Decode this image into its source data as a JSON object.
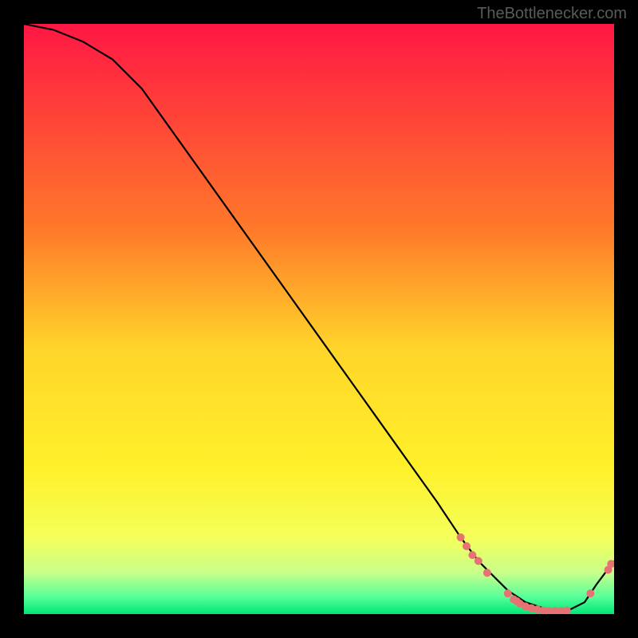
{
  "watermark": "TheBottlenecker.com",
  "chart_data": {
    "type": "line",
    "title": "",
    "xlabel": "",
    "ylabel": "",
    "xlim": [
      0,
      100
    ],
    "ylim": [
      0,
      100
    ],
    "background_gradient": {
      "stops": [
        {
          "offset": 0,
          "color": "#ff1744"
        },
        {
          "offset": 35,
          "color": "#ff7a2a"
        },
        {
          "offset": 55,
          "color": "#ffd52a"
        },
        {
          "offset": 75,
          "color": "#fff02a"
        },
        {
          "offset": 87,
          "color": "#f5ff5a"
        },
        {
          "offset": 93,
          "color": "#c8ff8a"
        },
        {
          "offset": 97,
          "color": "#5aff9a"
        },
        {
          "offset": 100,
          "color": "#00e676"
        }
      ]
    },
    "series": [
      {
        "name": "curve",
        "x": [
          0,
          5,
          10,
          15,
          20,
          25,
          30,
          35,
          40,
          45,
          50,
          55,
          60,
          65,
          70,
          74,
          77,
          80,
          82,
          85,
          88,
          90,
          92,
          95,
          97,
          100
        ],
        "y": [
          100,
          99,
          97,
          94,
          89,
          82,
          75,
          68,
          61,
          54,
          47,
          40,
          33,
          26,
          19,
          13,
          9,
          6,
          4,
          2,
          1,
          0.5,
          0.5,
          2,
          5,
          9
        ]
      }
    ],
    "markers": {
      "name": "optimum-cluster",
      "color": "#e57373",
      "radius": 5,
      "points": [
        {
          "x": 74,
          "y": 13
        },
        {
          "x": 75,
          "y": 11.5
        },
        {
          "x": 76,
          "y": 10
        },
        {
          "x": 77,
          "y": 9
        },
        {
          "x": 78.5,
          "y": 7
        },
        {
          "x": 82,
          "y": 3.5
        },
        {
          "x": 83,
          "y": 2.5
        },
        {
          "x": 83.5,
          "y": 2.2
        },
        {
          "x": 84,
          "y": 1.8
        },
        {
          "x": 85,
          "y": 1.3
        },
        {
          "x": 86,
          "y": 1.0
        },
        {
          "x": 87,
          "y": 0.8
        },
        {
          "x": 88,
          "y": 0.6
        },
        {
          "x": 89,
          "y": 0.5
        },
        {
          "x": 90,
          "y": 0.5
        },
        {
          "x": 91,
          "y": 0.5
        },
        {
          "x": 92,
          "y": 0.6
        },
        {
          "x": 96,
          "y": 3.5
        },
        {
          "x": 99,
          "y": 7.5
        },
        {
          "x": 99.5,
          "y": 8.5
        }
      ]
    }
  }
}
